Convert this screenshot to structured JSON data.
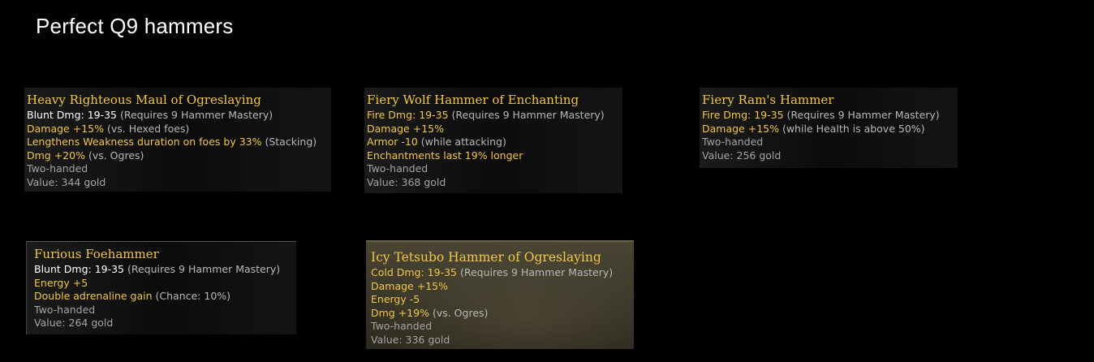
{
  "page": {
    "title": "Perfect Q9 hammers"
  },
  "tooltips": [
    {
      "name": "Heavy Righteous Maul of Ogreslaying",
      "lines": [
        {
          "main": "Blunt Dmg: 19-35",
          "note": " (Requires 9 Hammer Mastery)",
          "color": "white"
        },
        {
          "main": "Damage +15%",
          "note": " (vs. Hexed foes)",
          "color": "gold"
        },
        {
          "main": "Lengthens Weakness duration on foes by 33%",
          "note": " (Stacking)",
          "color": "gold"
        },
        {
          "main": "Dmg +20%",
          "note": " (vs. Ogres)",
          "color": "gold"
        },
        {
          "main": "Two-handed",
          "note": "",
          "color": "grey"
        },
        {
          "main": "Value: 344 gold",
          "note": "",
          "color": "grey"
        }
      ]
    },
    {
      "name": "Fiery Wolf Hammer of Enchanting",
      "lines": [
        {
          "main": "Fire Dmg: 19-35",
          "note": " (Requires 9 Hammer Mastery)",
          "color": "gold"
        },
        {
          "main": "Damage +15%",
          "note": "",
          "color": "gold"
        },
        {
          "main": "Armor -10",
          "note": " (while attacking)",
          "color": "gold"
        },
        {
          "main": "Enchantments last 19% longer",
          "note": "",
          "color": "gold"
        },
        {
          "main": "Two-handed",
          "note": "",
          "color": "grey"
        },
        {
          "main": "Value: 368 gold",
          "note": "",
          "color": "grey"
        }
      ]
    },
    {
      "name": "Fiery Ram's Hammer",
      "lines": [
        {
          "main": "Fire Dmg: 19-35",
          "note": " (Requires 9 Hammer Mastery)",
          "color": "gold"
        },
        {
          "main": "Damage +15%",
          "note": " (while Health is above 50%)",
          "color": "gold"
        },
        {
          "main": "Two-handed",
          "note": "",
          "color": "grey"
        },
        {
          "main": "Value: 256 gold",
          "note": "",
          "color": "grey"
        }
      ]
    },
    {
      "name": "Furious Foehammer",
      "lines": [
        {
          "main": "Blunt Dmg: 19-35",
          "note": " (Requires 9 Hammer Mastery)",
          "color": "white"
        },
        {
          "main": "Energy +5",
          "note": "",
          "color": "gold"
        },
        {
          "main": "Double adrenaline gain",
          "note": " (Chance: 10%)",
          "color": "gold"
        },
        {
          "main": "Two-handed",
          "note": "",
          "color": "grey"
        },
        {
          "main": "Value: 264 gold",
          "note": "",
          "color": "grey"
        }
      ]
    },
    {
      "name": "Icy Tetsubo Hammer of Ogreslaying",
      "lines": [
        {
          "main": "Cold Dmg: 19-35",
          "note": " (Requires 9 Hammer Mastery)",
          "color": "gold"
        },
        {
          "main": "Damage +15%",
          "note": "",
          "color": "gold"
        },
        {
          "main": "Energy -5",
          "note": "",
          "color": "gold"
        },
        {
          "main": "Dmg +19%",
          "note": " (vs. Ogres)",
          "color": "gold"
        },
        {
          "main": "Two-handed",
          "note": "",
          "color": "grey"
        },
        {
          "main": "Value: 336 gold",
          "note": "",
          "color": "grey"
        }
      ]
    }
  ]
}
